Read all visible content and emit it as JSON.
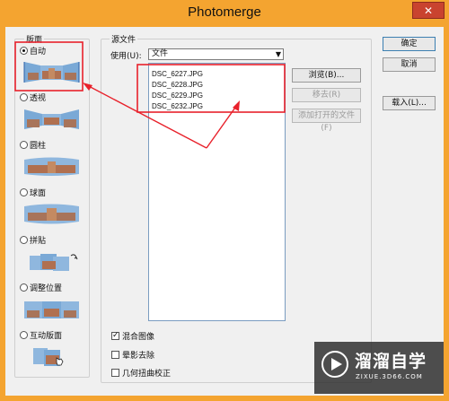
{
  "window": {
    "title": "Photomerge",
    "close_label": "✕"
  },
  "layout_group": {
    "label": "版面",
    "options": [
      {
        "label": "自动",
        "selected": true
      },
      {
        "label": "透视",
        "selected": false
      },
      {
        "label": "圆柱",
        "selected": false
      },
      {
        "label": "球面",
        "selected": false
      },
      {
        "label": "拼贴",
        "selected": false
      },
      {
        "label": "调整位置",
        "selected": false
      },
      {
        "label": "互动版面",
        "selected": false
      }
    ]
  },
  "source_group": {
    "label": "源文件",
    "use_label": "使用(U):",
    "use_value": "文件",
    "files": [
      "DSC_6227.JPG",
      "DSC_6228.JPG",
      "DSC_6229.JPG",
      "DSC_6232.JPG"
    ],
    "browse_label": "浏览(B)...",
    "remove_label": "移去(R)",
    "add_open_label": "添加打开的文件(F)"
  },
  "options": [
    {
      "label": "混合图像",
      "checked": true
    },
    {
      "label": "晕影去除",
      "checked": false
    },
    {
      "label": "几何扭曲校正",
      "checked": false
    }
  ],
  "buttons": {
    "ok_label": "确定",
    "cancel_label": "取消",
    "load_label": "载入(L)..."
  },
  "watermark": {
    "name": "溜溜自学",
    "url": "ZIXUE.3D66.COM"
  },
  "colors": {
    "title_bar": "#f4a430",
    "annotation_red": "#e8212b",
    "close_button": "#c9432f"
  }
}
